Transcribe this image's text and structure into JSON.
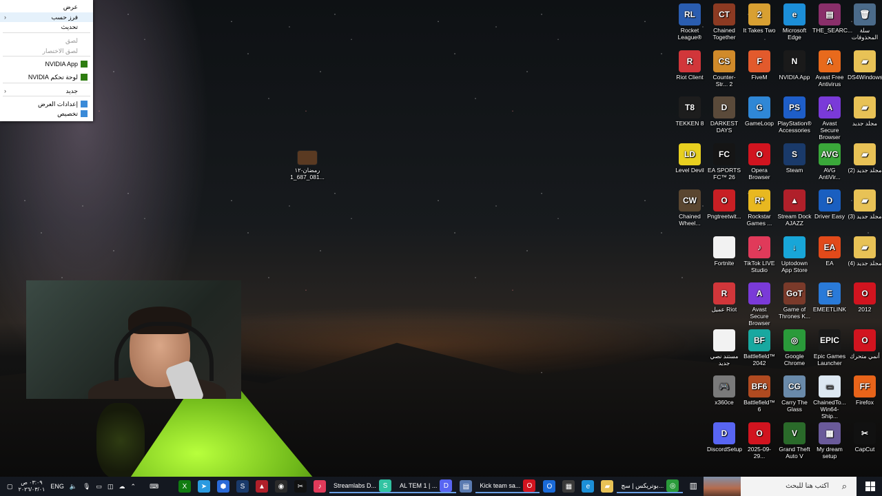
{
  "context_menu": {
    "items": [
      {
        "label": "عرض",
        "arrow": false,
        "disabled": false,
        "icon": ""
      },
      {
        "label": "فرز حسب",
        "arrow": true,
        "disabled": false,
        "icon": ""
      },
      {
        "label": "تحديث",
        "arrow": false,
        "disabled": false,
        "icon": ""
      },
      {
        "label": "لصق",
        "arrow": false,
        "disabled": true,
        "icon": ""
      },
      {
        "label": "لصق الاختصار",
        "arrow": false,
        "disabled": true,
        "icon": ""
      },
      {
        "label": "NVIDIA App",
        "arrow": false,
        "disabled": false,
        "icon": "nvidia-icon"
      },
      {
        "label": "لوحة تحكم NVIDIA",
        "arrow": false,
        "disabled": false,
        "icon": "nvidia-icon"
      },
      {
        "label": "جديد",
        "arrow": true,
        "disabled": false,
        "icon": ""
      },
      {
        "label": "إعدادات العرض",
        "arrow": false,
        "disabled": false,
        "icon": "display-icon"
      },
      {
        "label": "تخصيص",
        "arrow": false,
        "disabled": false,
        "icon": "personalize-icon"
      }
    ]
  },
  "desktop_file": {
    "label": "رمضان-١٢\n1_687_081..."
  },
  "desktop_icons": [
    {
      "label": "Rocket League®",
      "color": "#2a5db0",
      "glyph": "RL",
      "icon": "rocket-league-icon"
    },
    {
      "label": "Chained Together",
      "color": "#8c3a22",
      "glyph": "CT",
      "icon": "chained-together-icon"
    },
    {
      "label": "It Takes Two",
      "color": "#d8a032",
      "glyph": "2",
      "icon": "it-takes-two-icon"
    },
    {
      "label": "Microsoft Edge",
      "color": "#1c8fd8",
      "glyph": "e",
      "icon": "edge-icon"
    },
    {
      "label": "THE_SEARC...",
      "color": "#8a2f6a",
      "glyph": "▤",
      "icon": "winrar-icon"
    },
    {
      "label": "سلة المحذوفات",
      "color": "#4b6b8a",
      "glyph": "🗑",
      "icon": "recycle-bin-icon"
    },
    {
      "label": "Riot Client",
      "color": "#d1363a",
      "glyph": "R",
      "icon": "riot-client-icon"
    },
    {
      "label": "Counter-Str... 2",
      "color": "#d08a2a",
      "glyph": "CS",
      "icon": "counter-strike-icon"
    },
    {
      "label": "FiveM",
      "color": "#e25a2c",
      "glyph": "F",
      "icon": "fivem-icon"
    },
    {
      "label": "NVIDIA App",
      "color": "#1a1a1a",
      "glyph": "N",
      "icon": "nvidia-app-icon"
    },
    {
      "label": "Avast Free Antivirus",
      "color": "#e86a1c",
      "glyph": "A",
      "icon": "avast-icon"
    },
    {
      "label": "DS4Windows",
      "color": "#e8c256",
      "glyph": "▰",
      "icon": "folder-icon"
    },
    {
      "label": "TEKKEN 8",
      "color": "#1d1d1d",
      "glyph": "T8",
      "icon": "tekken-icon"
    },
    {
      "label": "DARKEST DAYS",
      "color": "#5a4a3a",
      "glyph": "D",
      "icon": "darkest-days-icon"
    },
    {
      "label": "GameLoop",
      "color": "#2f87d6",
      "glyph": "G",
      "icon": "gameloop-icon"
    },
    {
      "label": "PlayStation® Accessories",
      "color": "#1e5ec8",
      "glyph": "PS",
      "icon": "playstation-icon"
    },
    {
      "label": "Avast Secure Browser",
      "color": "#7a3ad8",
      "glyph": "A",
      "icon": "avast-browser-icon"
    },
    {
      "label": "مجلد جديد",
      "color": "#e8c256",
      "glyph": "▰",
      "icon": "folder-icon"
    },
    {
      "label": "Level Devil",
      "color": "#e8d020",
      "glyph": "LD",
      "icon": "level-devil-icon"
    },
    {
      "label": "EA SPORTS FC™ 26",
      "color": "#151515",
      "glyph": "FC",
      "icon": "ea-fc-icon"
    },
    {
      "label": "Opera Browser",
      "color": "#d1141f",
      "glyph": "O",
      "icon": "opera-icon"
    },
    {
      "label": "Steam",
      "color": "#1a3a6a",
      "glyph": "S",
      "icon": "steam-icon"
    },
    {
      "label": "AVG AntiVir...",
      "color": "#3aa83a",
      "glyph": "AVG",
      "icon": "avg-icon"
    },
    {
      "label": "مجلد جديد (2)",
      "color": "#e8c256",
      "glyph": "▰",
      "icon": "folder-icon"
    },
    {
      "label": "Chained Wheel...",
      "color": "#5a4630",
      "glyph": "CW",
      "icon": "chained-wheel-icon"
    },
    {
      "label": "Pngtreetwit...",
      "color": "#c81f24",
      "glyph": "O",
      "icon": "opera-gx-icon"
    },
    {
      "label": "Rockstar Games ...",
      "color": "#e8b820",
      "glyph": "R*",
      "icon": "rockstar-icon"
    },
    {
      "label": "Stream Dock AJAZZ",
      "color": "#b0202a",
      "glyph": "▲",
      "icon": "stream-dock-icon"
    },
    {
      "label": "Driver Easy",
      "color": "#1a5fc0",
      "glyph": "D",
      "icon": "driver-easy-icon"
    },
    {
      "label": "مجلد جديد (3)",
      "color": "#e8c256",
      "glyph": "▰",
      "icon": "folder-icon"
    },
    {
      "label": "Fortnite",
      "color": "#f2f2f2",
      "glyph": "",
      "icon": "file-icon"
    },
    {
      "label": "TikTok LIVE Studio",
      "color": "#e03a5a",
      "glyph": "♪",
      "icon": "tiktok-icon"
    },
    {
      "label": "Uptodown App Store",
      "color": "#18a6d8",
      "glyph": "↓",
      "icon": "uptodown-icon"
    },
    {
      "label": "EA",
      "color": "#e24a1a",
      "glyph": "EA",
      "icon": "ea-icon"
    },
    {
      "label": "مجلد جديد (4)",
      "color": "#e8c256",
      "glyph": "▰",
      "icon": "folder-icon"
    },
    {
      "label": "عميل Riot",
      "color": "#d1363a",
      "glyph": "R",
      "icon": "riot-client-icon"
    },
    {
      "label": "Avast Secure Browser",
      "color": "#7a3ad8",
      "glyph": "A",
      "icon": "avast-browser-icon"
    },
    {
      "label": "Game of Thrones K...",
      "color": "#7a3a2a",
      "glyph": "GoT",
      "icon": "game-of-thrones-icon"
    },
    {
      "label": "EMEETLINK",
      "color": "#2a7ad8",
      "glyph": "E",
      "icon": "emeetlink-icon"
    },
    {
      "label": "2012",
      "color": "#d1141f",
      "glyph": "O",
      "icon": "opera-icon"
    },
    {
      "label": "مستند نصي جديد",
      "color": "#f2f2f2",
      "glyph": "",
      "icon": "text-document-icon"
    },
    {
      "label": "Battlefield™ 2042",
      "color": "#18a8a0",
      "glyph": "BF",
      "icon": "battlefield-2042-icon"
    },
    {
      "label": "Google Chrome",
      "color": "#2a9a3a",
      "glyph": "◎",
      "icon": "chrome-icon"
    },
    {
      "label": "Epic Games Launcher",
      "color": "#1a1a1a",
      "glyph": "EPIC",
      "icon": "epic-games-icon"
    },
    {
      "label": "أنمي متحرك",
      "color": "#d1141f",
      "glyph": "O",
      "icon": "opera-icon"
    },
    {
      "label": "x360ce",
      "color": "#7a7a7a",
      "glyph": "🎮",
      "icon": "gamepad-icon"
    },
    {
      "label": "Battlefield™ 6",
      "color": "#b04a20",
      "glyph": "BF6",
      "icon": "battlefield-6-icon"
    },
    {
      "label": "Carry The Glass",
      "color": "#6a8aaa",
      "glyph": "CG",
      "icon": "carry-the-glass-icon"
    },
    {
      "label": "ChainedTo... Win64-Ship...",
      "color": "#dde8f2",
      "glyph": "▭",
      "icon": "exe-window-icon"
    },
    {
      "label": "Firefox",
      "color": "#e8641a",
      "glyph": "FF",
      "icon": "firefox-icon"
    },
    {
      "label": "DiscordSetup",
      "color": "#5865f2",
      "glyph": "D",
      "icon": "discord-icon"
    },
    {
      "label": "2025-09-29...",
      "color": "#d1141f",
      "glyph": "O",
      "icon": "opera-icon"
    },
    {
      "label": "Grand Theft Auto V",
      "color": "#2a6a2a",
      "glyph": "V",
      "icon": "gta-icon"
    },
    {
      "label": "My dream setup",
      "color": "#6a5a9a",
      "glyph": "▦",
      "icon": "image-icon"
    },
    {
      "label": "CapCut",
      "color": "#111111",
      "glyph": "✂",
      "icon": "capcut-icon"
    }
  ],
  "taskbar": {
    "search_placeholder": "اكتب هنا للبحث",
    "tasks": [
      {
        "label": "بوتريكس | سج...",
        "icon": "chrome-icon",
        "color": "#2a9a3a",
        "glyph": "◎",
        "active": true
      },
      {
        "label": "",
        "icon": "file-explorer-icon",
        "color": "#e8c256",
        "glyph": "▰",
        "active": false
      },
      {
        "label": "",
        "icon": "edge-icon",
        "color": "#1c8fd8",
        "glyph": "e",
        "active": false
      },
      {
        "label": "",
        "icon": "store-icon",
        "color": "#3a3a3a",
        "glyph": "▦",
        "active": false
      },
      {
        "label": "",
        "icon": "outlook-icon",
        "color": "#1a6ad8",
        "glyph": "O",
        "active": false
      },
      {
        "label": "Kick team sa...",
        "icon": "opera-icon",
        "color": "#d1141f",
        "glyph": "O",
        "active": true
      },
      {
        "label": "",
        "icon": "notepad-icon",
        "color": "#5a7ab0",
        "glyph": "▤",
        "active": false
      },
      {
        "label": "AL TEM 1 | ...",
        "icon": "discord-icon",
        "color": "#5865f2",
        "glyph": "D",
        "active": true
      },
      {
        "label": "Streamlabs D...",
        "icon": "streamlabs-icon",
        "color": "#31c3a2",
        "glyph": "S",
        "active": true
      },
      {
        "label": "",
        "icon": "tiktok-icon",
        "color": "#e03a5a",
        "glyph": "♪",
        "active": false
      },
      {
        "label": "",
        "icon": "capcut-icon",
        "color": "#111",
        "glyph": "✂",
        "active": false
      },
      {
        "label": "",
        "icon": "obs-icon",
        "color": "#2a2a2a",
        "glyph": "◉",
        "active": false
      },
      {
        "label": "",
        "icon": "stream-dock-icon",
        "color": "#b0202a",
        "glyph": "▲",
        "active": false
      },
      {
        "label": "",
        "icon": "steam-icon",
        "color": "#1a3a6a",
        "glyph": "S",
        "active": false
      },
      {
        "label": "",
        "icon": "toolbox-icon",
        "color": "#2a6ad8",
        "glyph": "⬢",
        "active": false
      },
      {
        "label": "",
        "icon": "telegram-icon",
        "color": "#2a9ae0",
        "glyph": "➤",
        "active": false
      },
      {
        "label": "",
        "icon": "xbox-icon",
        "color": "#107c10",
        "glyph": "X",
        "active": false
      }
    ],
    "tray": {
      "time": "٠٣:٠٩ ص",
      "date": "٢٠٢٦/٠٣/٠١",
      "lang": "ENG"
    }
  }
}
